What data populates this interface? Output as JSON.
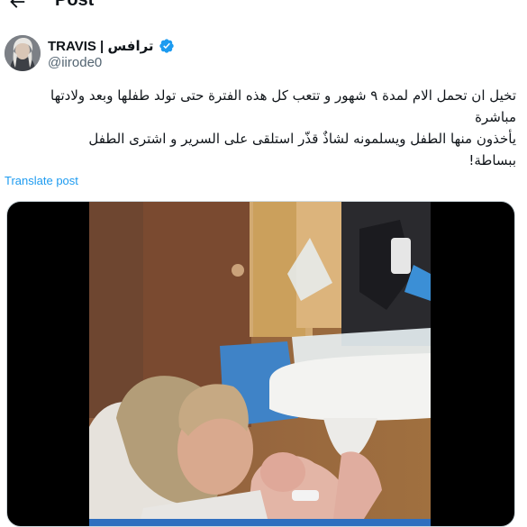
{
  "header": {
    "title": "Post",
    "back_icon": "arrow-left-icon"
  },
  "author": {
    "display_name": "TRAVIS | ترافس",
    "handle": "@iirode0",
    "verified": true,
    "verified_color": "#1d9bf0"
  },
  "post": {
    "lines": [
      "تخيل ان تحمل الام لمدة ٩ شهور و تتعب كل هذه الفترة حتى تولد طفلها وبعد ولادتها",
      "مباشرة",
      "يأخذون منها الطفل ويسلمونه لشاذٌ قذّر استلقى على السرير و اشترى الطفل",
      "ببساطة!"
    ],
    "translate_label": "Translate post"
  },
  "media": {
    "type": "video"
  },
  "colors": {
    "link": "#1d9bf0",
    "secondary_text": "#536471"
  }
}
